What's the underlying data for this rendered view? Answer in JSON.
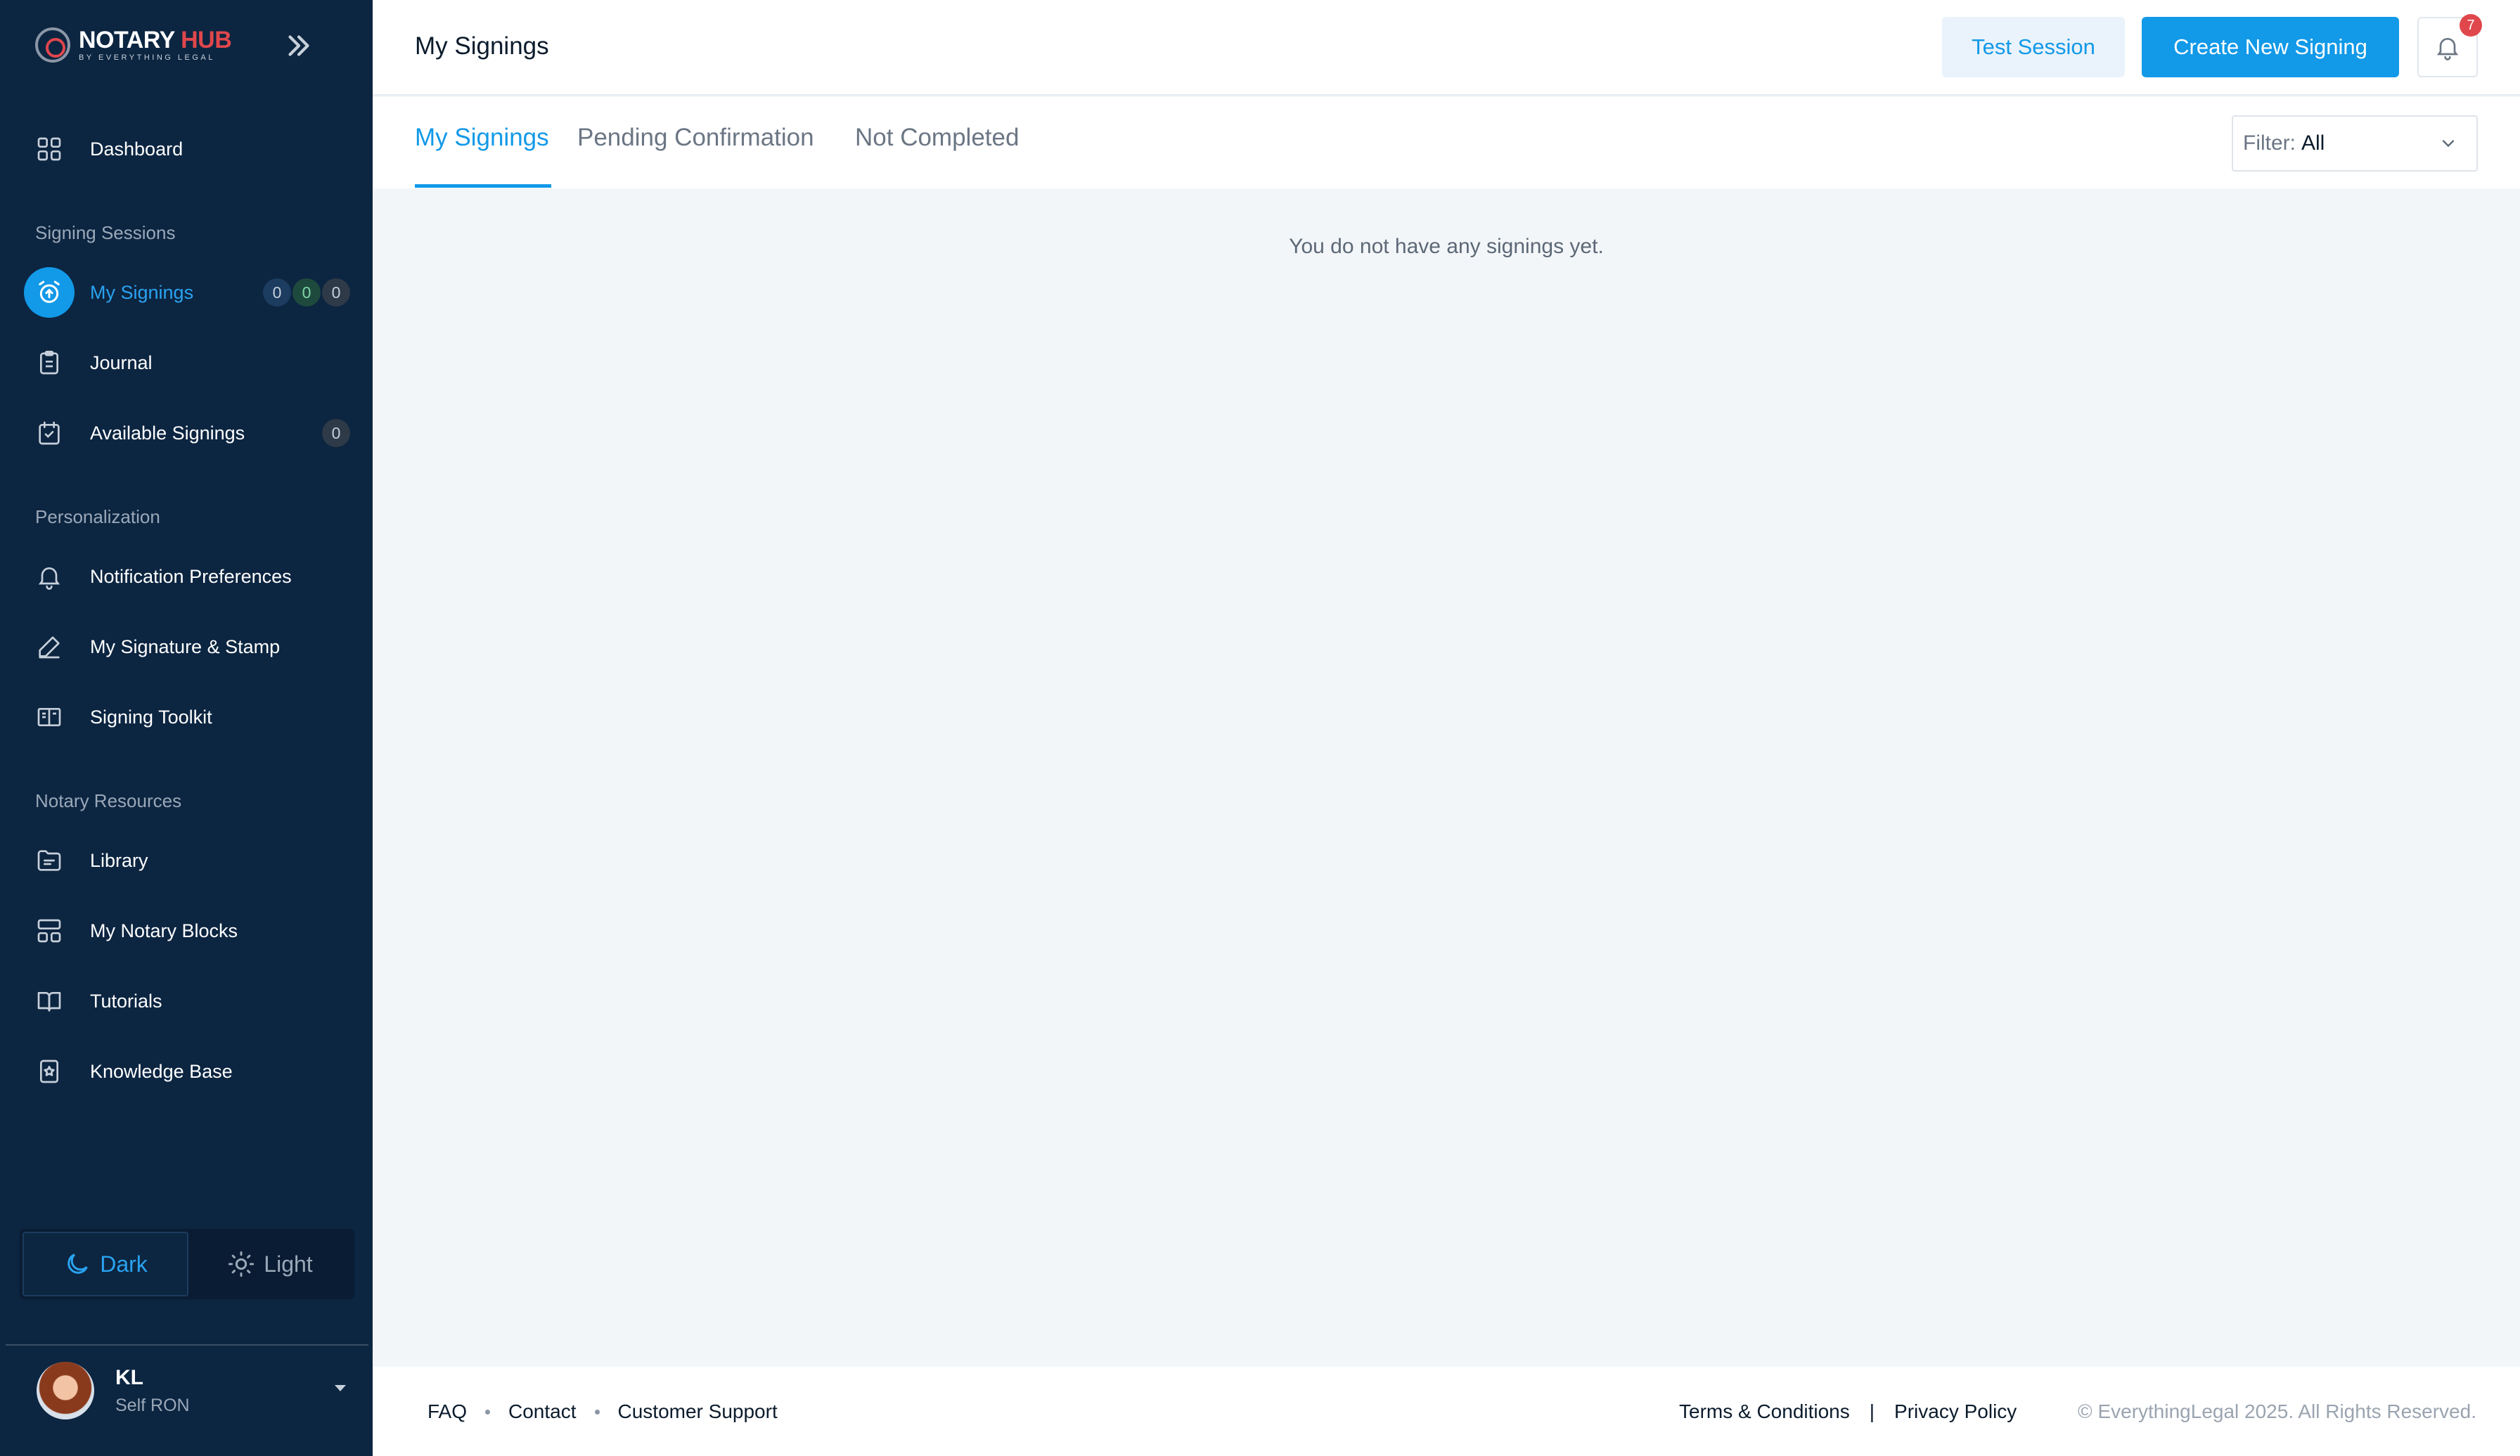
{
  "app": {
    "logo_title": "NOTARY",
    "logo_title_accent": "HUB",
    "logo_sub": "BY EVERYTHING LEGAL"
  },
  "sidebar": {
    "dashboard": "Dashboard",
    "sections": [
      "Signing Sessions",
      "Personalization",
      "Notary Resources"
    ],
    "items": {
      "my_signings": {
        "label": "My Signings",
        "badges": [
          "0",
          "0",
          "0"
        ]
      },
      "journal": {
        "label": "Journal"
      },
      "available_signings": {
        "label": "Available Signings",
        "badge": "0"
      },
      "notification_preferences": {
        "label": "Notification Preferences"
      },
      "signature_stamp": {
        "label": "My Signature & Stamp"
      },
      "signing_toolkit": {
        "label": "Signing Toolkit"
      },
      "library": {
        "label": "Library"
      },
      "notary_blocks": {
        "label": "My Notary Blocks"
      },
      "tutorials": {
        "label": "Tutorials"
      },
      "knowledge_base": {
        "label": "Knowledge Base"
      }
    },
    "theme": {
      "dark": "Dark",
      "light": "Light",
      "selected": "Dark"
    },
    "user": {
      "initials": "KL",
      "role": "Self RON"
    }
  },
  "header": {
    "title": "My Signings",
    "test_session": "Test Session",
    "create": "Create New Signing",
    "notifications_count": "7"
  },
  "tabs": [
    "My Signings",
    "Pending Confirmation",
    "Not Completed"
  ],
  "filter": {
    "label": "Filter:",
    "value": "All"
  },
  "main": {
    "empty_message": "You do not have any signings yet."
  },
  "footer": {
    "left_links": [
      "FAQ",
      "Contact",
      "Customer Support"
    ],
    "right_links": [
      "Terms & Conditions",
      "Privacy Policy"
    ],
    "copyright": "© EverythingLegal 2025. All Rights Reserved."
  },
  "colors": {
    "sidebar": "#0c2541",
    "accent": "#1299e8",
    "brand_red": "#e0474c"
  }
}
